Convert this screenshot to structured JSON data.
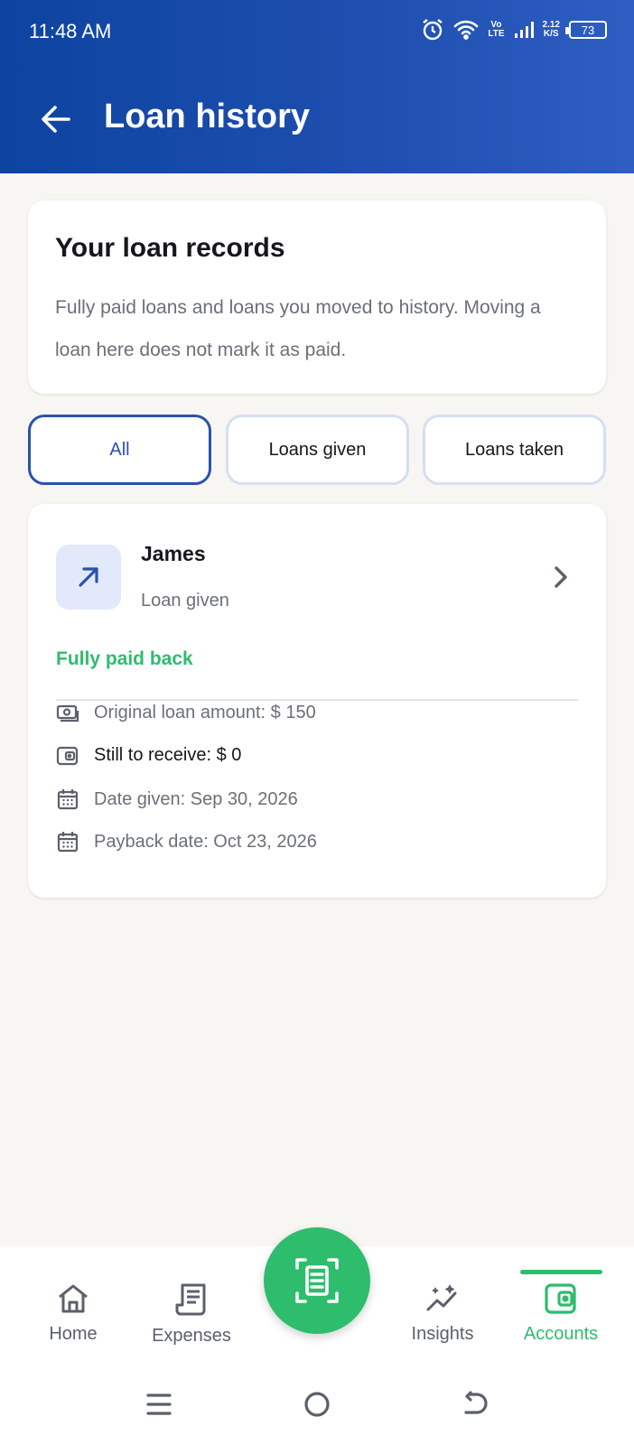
{
  "status_bar": {
    "time": "11:48 AM",
    "net_top": "Vo",
    "net_bottom": "LTE",
    "speed_value": "2.12",
    "speed_unit": "K/S",
    "battery": "73",
    "icons": [
      "alarm-icon",
      "wifi-icon",
      "signal-icon",
      "battery-icon"
    ]
  },
  "header": {
    "title": "Loan history",
    "back_icon": "arrow-left-icon"
  },
  "info_card": {
    "title": "Your loan records",
    "description": "Fully paid loans and loans you moved to history. Moving a loan here does not mark it as paid."
  },
  "filters": [
    {
      "label": "All",
      "active": true
    },
    {
      "label": "Loans given",
      "active": false
    },
    {
      "label": "Loans taken",
      "active": false
    }
  ],
  "loans": [
    {
      "name": "James",
      "type": "Loan given",
      "icon": "arrow-up-right-icon",
      "status": "Fully paid back",
      "details": [
        {
          "icon": "cash-icon",
          "text": "Original loan amount: $ 150"
        },
        {
          "icon": "wallet-icon",
          "text": "Still to receive: $ 0"
        },
        {
          "icon": "calendar-icon",
          "text": "Date given: Sep 30, 2026"
        },
        {
          "icon": "calendar-icon",
          "text": "Payback date: Oct 23, 2026"
        }
      ]
    }
  ],
  "bottom_nav": {
    "items": [
      {
        "label": "Home",
        "icon": "home-icon",
        "active": false
      },
      {
        "label": "Expenses",
        "icon": "receipt-icon",
        "active": false
      },
      {
        "label": "Insights",
        "icon": "insights-icon",
        "active": false
      },
      {
        "label": "Accounts",
        "icon": "wallet-icon",
        "active": true
      }
    ],
    "fab_icon": "scan-receipt-icon"
  },
  "system_nav": [
    "menu-icon",
    "home-circle-icon",
    "back-icon"
  ],
  "colors": {
    "header_blue": "#0d44a0",
    "accent_blue": "#2a52ad",
    "success_green": "#2ebc6d",
    "background": "#f8f6f2"
  }
}
